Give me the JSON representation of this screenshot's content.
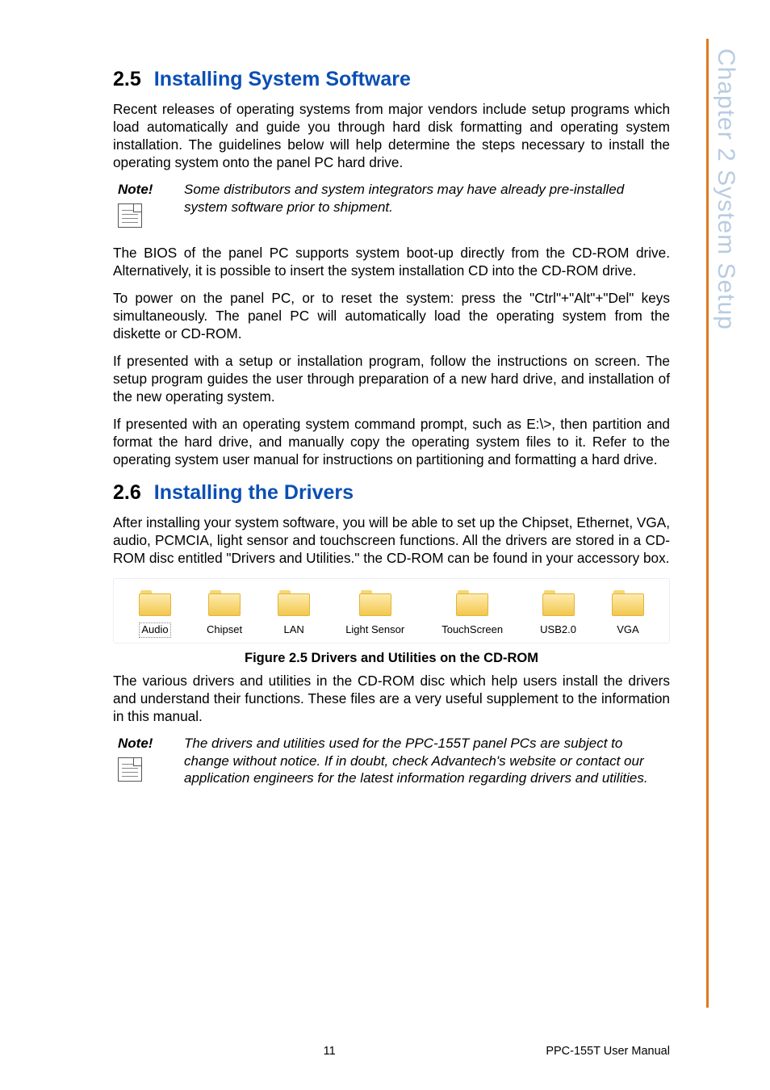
{
  "side_tab": "Chapter 2  System Setup",
  "sections": {
    "s25": {
      "num": "2.5",
      "title": "Installing System Software"
    },
    "s26": {
      "num": "2.6",
      "title": "Installing the Drivers"
    }
  },
  "paras": {
    "p25_1": "Recent releases of operating systems from major vendors include setup programs which load automatically and guide you through hard disk formatting and operating system installation. The guidelines below will help determine the steps necessary to install the operating system onto the panel PC hard drive.",
    "p25_2": "The BIOS of the panel PC supports system boot-up directly from the CD-ROM drive. Alternatively, it is possible to insert the system installation CD into the CD-ROM drive.",
    "p25_3": "To power on the panel PC, or to reset the system: press the \"Ctrl\"+\"Alt\"+\"Del\" keys simultaneously. The panel PC will automatically load the operating system from the diskette or CD-ROM.",
    "p25_4": "If presented with a setup or installation program, follow the instructions on screen. The setup program guides the user through preparation of a new hard drive, and installation of the new operating system.",
    "p25_5": "If presented with an operating system command prompt, such as E:\\>, then partition and format the hard drive, and manually copy the operating system files to it. Refer to the operating system user manual for instructions on partitioning and formatting a hard drive.",
    "p26_1": "After installing your system software, you will be able to set up the Chipset, Ethernet, VGA, audio, PCMCIA, light sensor and touchscreen functions. All the drivers are stored in a CD-ROM disc entitled \"Drivers and Utilities.\"  the CD-ROM can be found in your accessory box.",
    "p26_2": "The various drivers and utilities in the CD-ROM disc which help users install the drivers and understand their functions. These files are a very useful supplement to the information in this manual."
  },
  "notes": {
    "label": "Note!",
    "n1": "Some distributors and system integrators may have already pre-installed system software prior to shipment.",
    "n2": "The drivers and utilities used for the PPC-155T panel PCs are subject to change without notice. If in doubt, check Advantech's website or contact our application engineers for the latest information regarding drivers and utilities."
  },
  "folders": [
    "Audio",
    "Chipset",
    "LAN",
    "Light Sensor",
    "TouchScreen",
    "USB2.0",
    "VGA"
  ],
  "figure_caption": "Figure 2.5 Drivers and Utilities on the CD-ROM",
  "footer": {
    "page": "11",
    "doc": "PPC-155T User Manual"
  }
}
